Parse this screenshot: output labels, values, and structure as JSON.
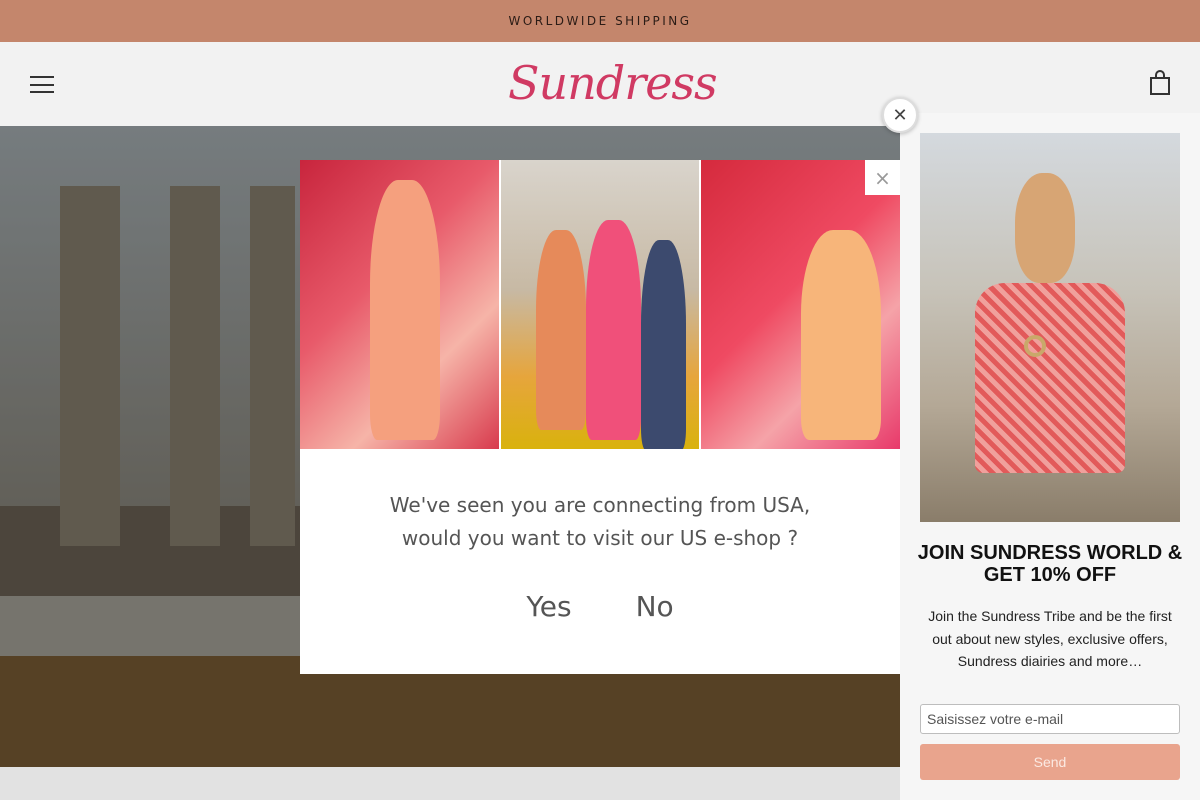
{
  "announcement": {
    "text": "WORLDWIDE SHIPPING"
  },
  "header": {
    "logo_text": "Sundress",
    "menu_icon": "hamburger-menu-icon",
    "cart_icon": "shopping-bag-icon"
  },
  "geo_modal": {
    "message_line1": "We've seen you are connecting from USA,",
    "message_line2": "would you want to visit our US e-shop ?",
    "yes_label": "Yes",
    "no_label": "No",
    "close_label": "×"
  },
  "newsletter": {
    "close_label": "✕",
    "title": "JOIN SUNDRESS WORLD & GET 10% OFF",
    "description": "Join the Sundress Tribe and be the first out about new styles, exclusive offers, Sundress diairies and more…",
    "email_placeholder": "Saisissez votre e-mail",
    "send_label": "Send"
  },
  "colors": {
    "announcement_bg": "#c4866c",
    "brand_pink": "#d03a63",
    "send_button": "#e9a48d"
  }
}
